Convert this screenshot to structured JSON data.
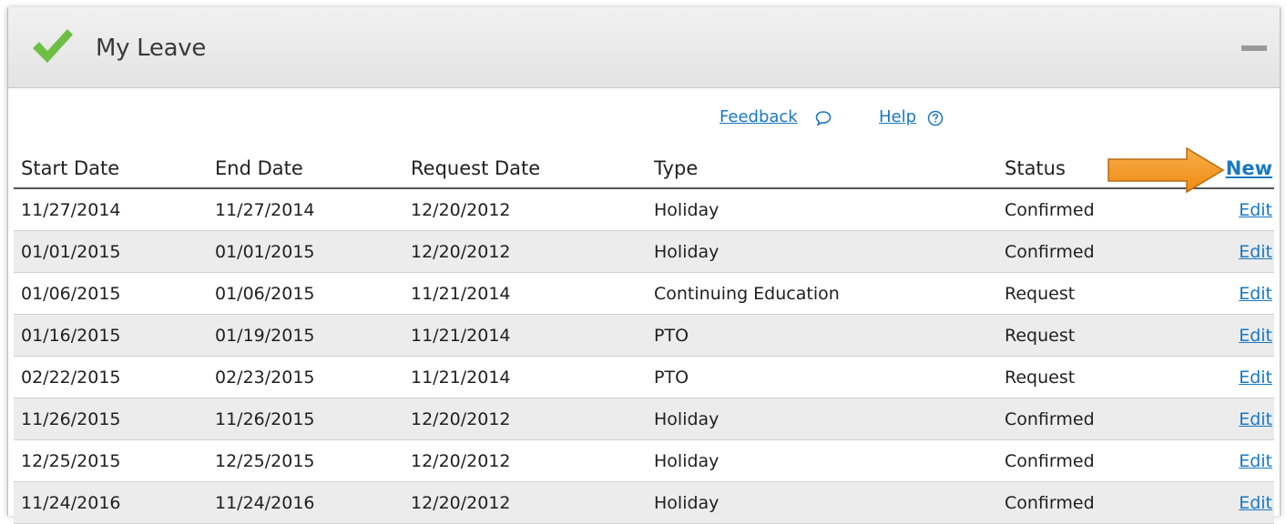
{
  "panel": {
    "title": "My Leave",
    "header_icon": "checkmark-icon",
    "collapse_icon": "minus-icon",
    "accent_color": "#6dbe45",
    "link_color": "#1a78c2"
  },
  "links": {
    "feedback_label": "Feedback",
    "feedback_icon": "speech-bubble-icon",
    "help_label": "Help",
    "help_icon": "question-circle-icon"
  },
  "table": {
    "columns": [
      "Start Date",
      "End Date",
      "Request Date",
      "Type",
      "Status"
    ],
    "new_label": "New",
    "edit_label": "Edit",
    "rows": [
      {
        "start": "11/27/2014",
        "end": "11/27/2014",
        "requested": "12/20/2012",
        "type": "Holiday",
        "status": "Confirmed"
      },
      {
        "start": "01/01/2015",
        "end": "01/01/2015",
        "requested": "12/20/2012",
        "type": "Holiday",
        "status": "Confirmed"
      },
      {
        "start": "01/06/2015",
        "end": "01/06/2015",
        "requested": "11/21/2014",
        "type": "Continuing Education",
        "status": "Request"
      },
      {
        "start": "01/16/2015",
        "end": "01/19/2015",
        "requested": "11/21/2014",
        "type": "PTO",
        "status": "Request"
      },
      {
        "start": "02/22/2015",
        "end": "02/23/2015",
        "requested": "11/21/2014",
        "type": "PTO",
        "status": "Request"
      },
      {
        "start": "11/26/2015",
        "end": "11/26/2015",
        "requested": "12/20/2012",
        "type": "Holiday",
        "status": "Confirmed"
      },
      {
        "start": "12/25/2015",
        "end": "12/25/2015",
        "requested": "12/20/2012",
        "type": "Holiday",
        "status": "Confirmed"
      },
      {
        "start": "11/24/2016",
        "end": "11/24/2016",
        "requested": "12/20/2012",
        "type": "Holiday",
        "status": "Confirmed"
      }
    ]
  },
  "annotation": {
    "arrow_icon": "orange-arrow-icon",
    "arrow_color": "#f39a1e"
  }
}
